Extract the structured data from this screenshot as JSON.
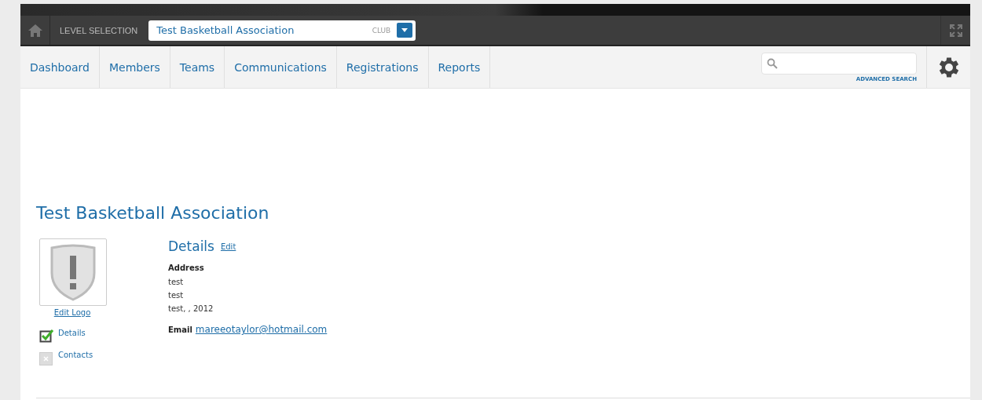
{
  "top_bar": {
    "level_label": "LEVEL SELECTION",
    "level_value": "Test Basketball Association",
    "level_type": "CLUB"
  },
  "nav": {
    "items": [
      {
        "label": "Dashboard",
        "selected": false
      },
      {
        "label": "Members",
        "selected": false
      },
      {
        "label": "Teams",
        "selected": false
      },
      {
        "label": "Communications",
        "selected": false
      },
      {
        "label": "Registrations",
        "selected": false
      },
      {
        "label": "Reports",
        "selected": false
      }
    ],
    "search": {
      "advanced_link": "ADVANCED SEARCH"
    }
  },
  "page": {
    "title": "Test Basketball Association",
    "edit_logo": "Edit Logo",
    "checklist": [
      {
        "label": "Details",
        "checked": true
      },
      {
        "label": "Contacts",
        "checked": false
      }
    ],
    "details": {
      "heading": "Details",
      "edit_link": "Edit",
      "address_label": "Address",
      "address_lines": [
        "test",
        "test",
        "test, , 2012"
      ],
      "email_label": "Email",
      "email": "mareeotaylor@hotmail.com"
    }
  }
}
